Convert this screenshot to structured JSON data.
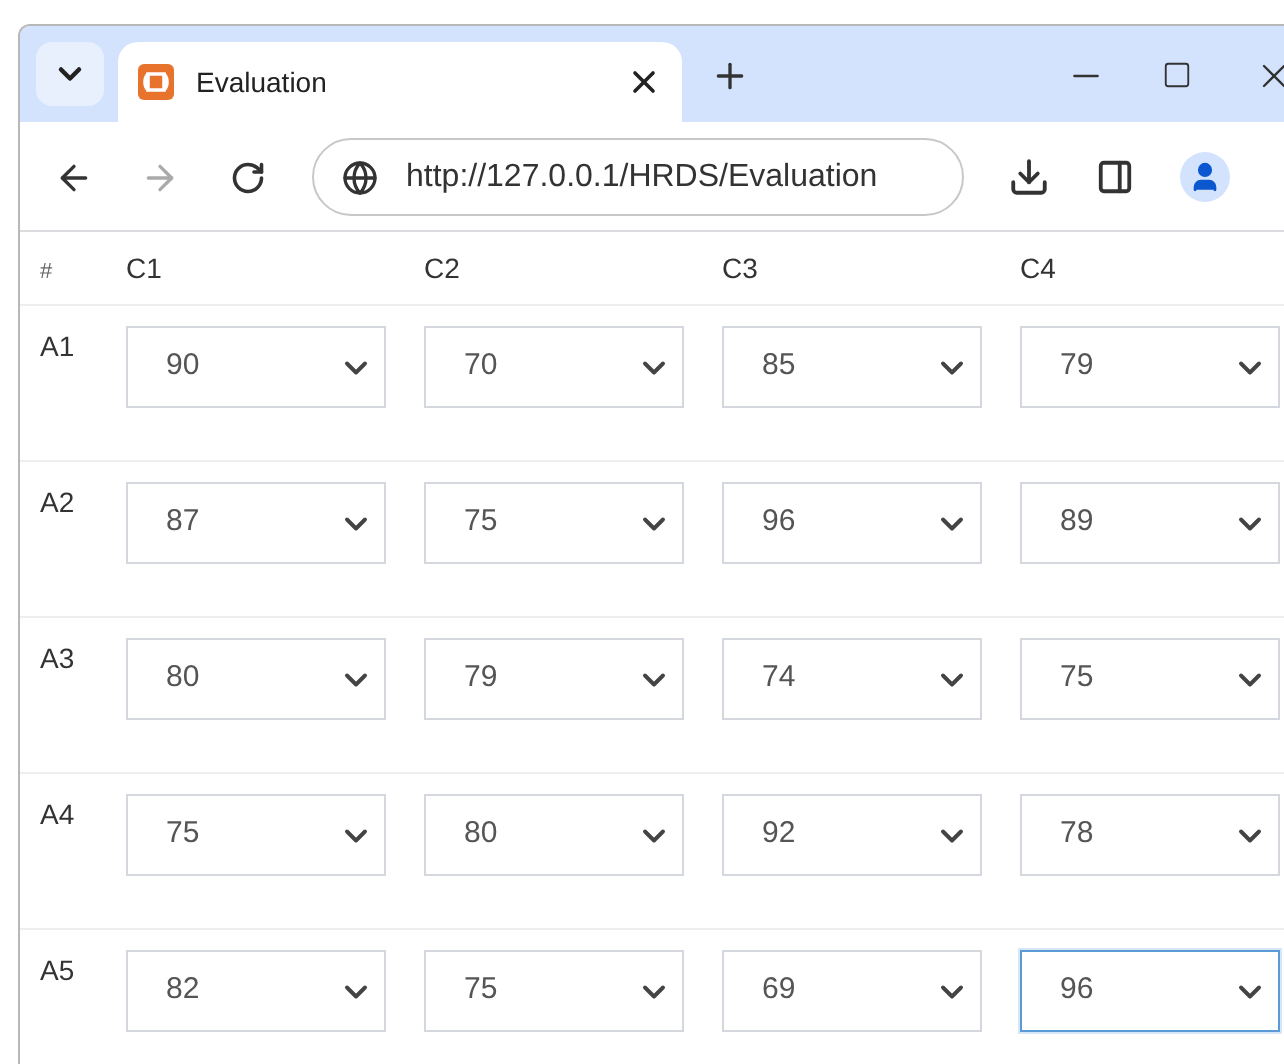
{
  "browser": {
    "tab_title": "Evaluation",
    "url": "http://127.0.0.1/HRDS/Evaluation"
  },
  "table": {
    "columns": [
      "#",
      "C1",
      "C2",
      "C3",
      "C4"
    ],
    "rows": [
      {
        "label": "A1",
        "cells": [
          {
            "value": "90",
            "focused": false
          },
          {
            "value": "70",
            "focused": false
          },
          {
            "value": "85",
            "focused": false
          },
          {
            "value": "79",
            "focused": false
          }
        ]
      },
      {
        "label": "A2",
        "cells": [
          {
            "value": "87",
            "focused": false
          },
          {
            "value": "75",
            "focused": false
          },
          {
            "value": "96",
            "focused": false
          },
          {
            "value": "89",
            "focused": false
          }
        ]
      },
      {
        "label": "A3",
        "cells": [
          {
            "value": "80",
            "focused": false
          },
          {
            "value": "79",
            "focused": false
          },
          {
            "value": "74",
            "focused": false
          },
          {
            "value": "75",
            "focused": false
          }
        ]
      },
      {
        "label": "A4",
        "cells": [
          {
            "value": "75",
            "focused": false
          },
          {
            "value": "80",
            "focused": false
          },
          {
            "value": "92",
            "focused": false
          },
          {
            "value": "78",
            "focused": false
          }
        ]
      },
      {
        "label": "A5",
        "cells": [
          {
            "value": "82",
            "focused": false
          },
          {
            "value": "75",
            "focused": false
          },
          {
            "value": "69",
            "focused": false
          },
          {
            "value": "96",
            "focused": true
          }
        ]
      }
    ]
  }
}
